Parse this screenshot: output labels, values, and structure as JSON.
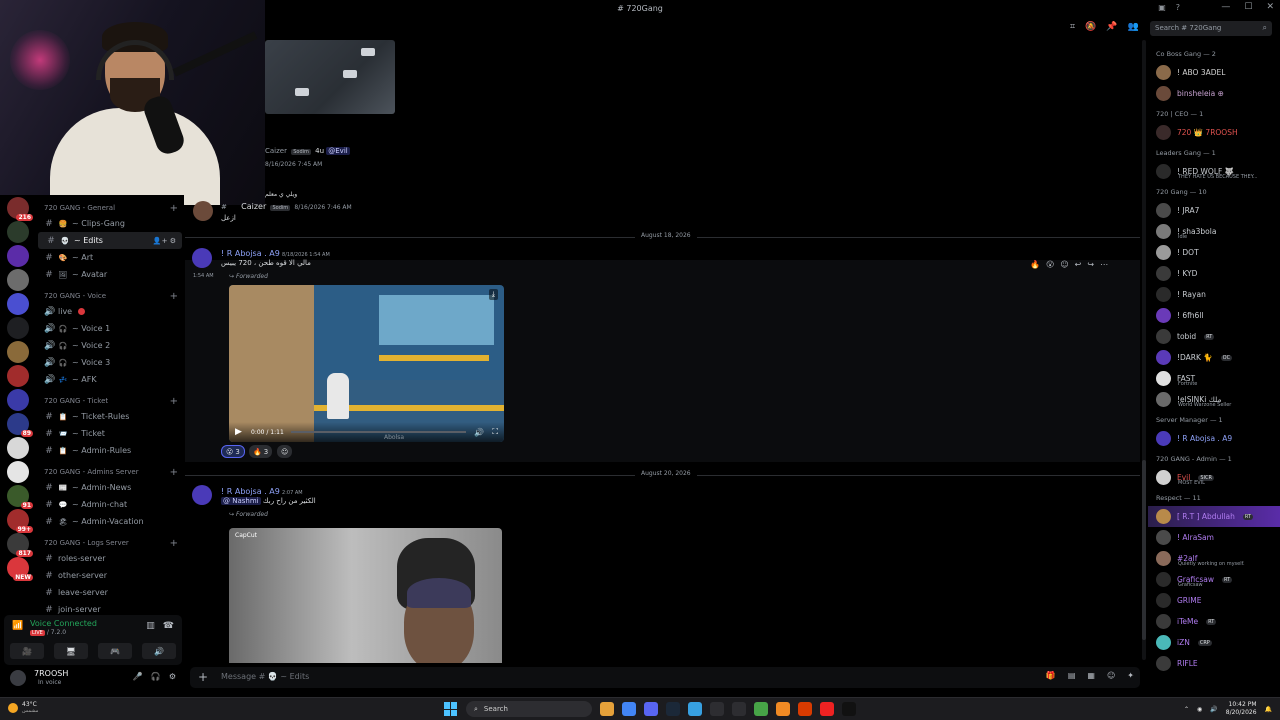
{
  "window": {
    "title": "# 720Gang"
  },
  "colors": {
    "accent": "#5865f2",
    "online": "#23a55a",
    "alert": "#da373c",
    "background": "#000000"
  },
  "rail": {
    "servers": [
      {
        "badge": "216",
        "color": "#7a2c2c"
      },
      {
        "badge": "",
        "color": "#2b3b2b"
      },
      {
        "badge": "",
        "color": "#5b2ca8"
      },
      {
        "badge": "",
        "color": "#6c6c6c"
      },
      {
        "badge": "",
        "color": "#4a4fd1"
      },
      {
        "badge": "",
        "color": "#1e1f22"
      },
      {
        "badge": "",
        "color": "#8a6a3a"
      },
      {
        "badge": "",
        "color": "#a12c2c"
      },
      {
        "badge": "",
        "color": "#3a3aa8"
      },
      {
        "badge": "89",
        "color": "#2c3a8a"
      },
      {
        "badge": "",
        "color": "#d8d8d8"
      },
      {
        "badge": "",
        "color": "#e5e5e5"
      },
      {
        "badge": "91",
        "color": "#3a5a2a"
      },
      {
        "badge": "99+",
        "color": "#a12c2c"
      },
      {
        "badge": "817",
        "color": "#3a3a3a"
      },
      {
        "badge": "NEW",
        "color": "#da373c"
      }
    ]
  },
  "sidebar": {
    "categories": [
      {
        "label": "720 GANG - General",
        "channels": [
          {
            "hash": "#",
            "emoji": "🍔",
            "label": "~ Clips-Gang"
          },
          {
            "hash": "#",
            "emoji": "💀",
            "label": "~ Edits",
            "active": true
          },
          {
            "hash": "#",
            "emoji": "🎨",
            "label": "~ Art"
          },
          {
            "hash": "#",
            "emoji": "🖼",
            "label": "~ Avatar"
          }
        ]
      },
      {
        "label": "720 GANG - Voice",
        "channels": [
          {
            "hash": "🔊",
            "emoji": "",
            "label": "live",
            "live": true
          },
          {
            "hash": "🔊",
            "emoji": "🎧",
            "label": "~ Voice 1"
          },
          {
            "hash": "🔊",
            "emoji": "🎧",
            "label": "~ Voice 2"
          },
          {
            "hash": "🔊",
            "emoji": "🎧",
            "label": "~ Voice 3"
          },
          {
            "hash": "🔊",
            "emoji": "💤",
            "label": "~ AFK"
          }
        ]
      },
      {
        "label": "720 GANG - Ticket",
        "channels": [
          {
            "hash": "#",
            "emoji": "📋",
            "label": "~ Ticket-Rules"
          },
          {
            "hash": "#",
            "emoji": "📨",
            "label": "~ Ticket"
          },
          {
            "hash": "#",
            "emoji": "📋",
            "label": "~ Admin-Rules"
          }
        ]
      },
      {
        "label": "720 GANG - Admins Server",
        "channels": [
          {
            "hash": "#",
            "emoji": "📰",
            "label": "~ Admin-News"
          },
          {
            "hash": "#",
            "emoji": "💬",
            "label": "~ Admin-chat"
          },
          {
            "hash": "#",
            "emoji": "🏖",
            "label": "~ Admin-Vacation"
          }
        ]
      },
      {
        "label": "720 GANG - Logs Server",
        "channels": [
          {
            "hash": "#",
            "emoji": "",
            "label": "roles-server"
          },
          {
            "hash": "#",
            "emoji": "",
            "label": "other-server"
          },
          {
            "hash": "#",
            "emoji": "",
            "label": "leave-server"
          },
          {
            "hash": "#",
            "emoji": "",
            "label": "join-server"
          }
        ]
      }
    ]
  },
  "voice_panel": {
    "status": "Voice Connected",
    "badge": "LIVE",
    "server": "/ 7.2.0",
    "buttons": [
      "🎥",
      "🖥",
      "🎮",
      "🔊"
    ]
  },
  "user_panel": {
    "name": "7ROOSH",
    "status": "In voice"
  },
  "header": {
    "search_placeholder": "Search # 720Gang"
  },
  "messages": {
    "msg1": {
      "author": "Caizer",
      "tag": "Sodim",
      "text": "4u",
      "mention": "@Evil",
      "time": "8/16/2026 7:45 AM"
    },
    "msg2": {
      "reply": "ويلي ي معلم",
      "author": "Caizer",
      "tag": "Sodim",
      "time": "8/16/2026 7:46 AM",
      "text": "ازعل"
    },
    "divider1": "August 18, 2026",
    "msg3": {
      "author": "! R Abojsa . A9",
      "time": "8/18/2026 1:54 AM",
      "text": "مالي الا قوه طحن ، 720 يبيس",
      "side_time": "1:54 AM",
      "forwarded": "Forwarded",
      "video": {
        "time": "0:00 / 1:11",
        "watermark": "Abolsa"
      },
      "reactions": [
        {
          "emoji": "😮",
          "count": "3"
        },
        {
          "emoji": "🔥",
          "count": "3"
        }
      ]
    },
    "divider2": "August 20, 2026",
    "msg4": {
      "author": "! R Abojsa . A9",
      "time": "2:07 AM",
      "mention": "@ Nashmi",
      "text": "الكثير من راح ربك",
      "forwarded": "Forwarded",
      "image_watermark": "CapCut"
    }
  },
  "composer": {
    "placeholder": "Message # 💀 ~ Edits"
  },
  "members": [
    {
      "role": "Co Boss Gang — 2",
      "users": [
        {
          "name": "! ABO 3ADEL",
          "color": "#d0d0d0",
          "av": "#8a6a4a"
        },
        {
          "name": "binsheleia ⊕",
          "color": "#c7a2d0",
          "av": "#6a4a3a"
        }
      ]
    },
    {
      "role": "720 | CEO — 1",
      "users": [
        {
          "name": "720 👑 7ROOSH",
          "color": "#e0524f",
          "av": "#3a2a2a"
        }
      ]
    },
    {
      "role": "Leaders Gang — 1",
      "users": [
        {
          "name": "! RED WOLF 🐺",
          "color": "#c9cdd2",
          "sub": "THEY HATE US BECAUSE THEY...",
          "av": "#2a2a2a"
        }
      ]
    },
    {
      "role": "720 Gang — 10",
      "users": [
        {
          "name": "! JRA7",
          "color": "#c9cdd2",
          "av": "#4a4a4a"
        },
        {
          "name": "! sha3bola",
          "color": "#c9cdd2",
          "sub": "Idle",
          "av": "#7a7a7a"
        },
        {
          "name": "! DOT",
          "color": "#c9cdd2",
          "av": "#9a9a9a"
        },
        {
          "name": "! KYD",
          "color": "#c9cdd2",
          "av": "#3a3a3a"
        },
        {
          "name": "! Rayan",
          "color": "#c9cdd2",
          "av": "#2a2a2a"
        },
        {
          "name": "! 6fh6ll",
          "color": "#c9cdd2",
          "av": "#6a3ab8"
        },
        {
          "name": "tobid",
          "color": "#c9cdd2",
          "pill": "RT",
          "av": "#3a3a3a"
        },
        {
          "name": "!DARK 🐈",
          "color": "#c9cdd2",
          "pill": "OC",
          "av": "#5a3ab8"
        },
        {
          "name": "FAST",
          "color": "#c9cdd2",
          "sub": "Fortnite",
          "av": "#e0e0e0"
        },
        {
          "name": "!elSINKi ملك",
          "color": "#c9cdd2",
          "sub": "World Warzone Seller",
          "av": "#6a6a6a"
        }
      ]
    },
    {
      "role": "Server Manager — 1",
      "users": [
        {
          "name": "! R Abojsa . A9",
          "color": "#8ea1f7",
          "av": "#4a3ab8"
        }
      ]
    },
    {
      "role": "720 GANG - Admin — 1",
      "users": [
        {
          "name": "Evil",
          "color": "#e0524f",
          "pill": "SICR",
          "sub": "MOST EVIL",
          "av": "#d0d0d0"
        }
      ]
    },
    {
      "role": "Respect — 11",
      "users": [
        {
          "name": "[ R.T ] Abdullah",
          "color": "#b07cf0",
          "pill": "RT",
          "av": "#b88a4a",
          "hl": true
        },
        {
          "name": "! AlraSam",
          "color": "#b07cf0",
          "av": "#4a4a4a"
        },
        {
          "name": "#2alf",
          "color": "#b07cf0",
          "sub": "Quietly working on myself.",
          "av": "#8a6a5a"
        },
        {
          "name": "Graficsaw",
          "color": "#b07cf0",
          "pill": "RT",
          "sub": "Graficsaw",
          "av": "#2a2a2a"
        },
        {
          "name": "GRIME",
          "color": "#b07cf0",
          "av": "#2a2a2a"
        },
        {
          "name": "iTeMe",
          "color": "#b07cf0",
          "pill": "RT",
          "av": "#3a3a3a"
        },
        {
          "name": "iZN",
          "color": "#b07cf0",
          "pill": "CRP",
          "av": "#4ab8b8"
        },
        {
          "name": "RIFLE",
          "color": "#b07cf0",
          "av": "#3a3a3a"
        }
      ]
    }
  ],
  "taskbar": {
    "weather_temp": "43°C",
    "weather_desc": "مشمس",
    "search": "Search",
    "time": "10:42 PM",
    "date": "8/20/2026",
    "apps": [
      "#e5a13a",
      "#4285f4",
      "#5865f2",
      "#1b2838",
      "#37a0e0",
      "#2d2d31",
      "#2d2d31",
      "#47a447",
      "#f08a24",
      "#d83b01",
      "#e22",
      "#111"
    ]
  }
}
